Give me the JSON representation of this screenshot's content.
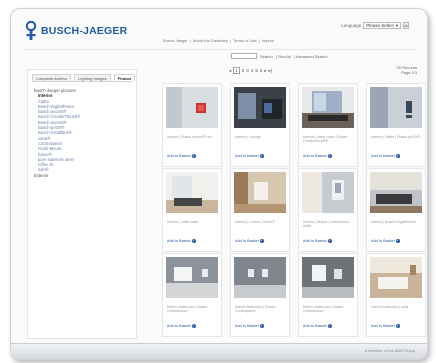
{
  "header": {
    "brand": "BUSCH-JAEGER",
    "language_label": "Language",
    "language_value": "Please Select",
    "language_ok": "ok",
    "top_links": [
      "Busch-Jaeger",
      "|",
      "About the Database",
      "|",
      "Terms of Use",
      "|",
      "Imprint"
    ]
  },
  "search": {
    "title": "Advanced Search | Extended Search",
    "placeholder": "",
    "search_label": "Search",
    "links": [
      "Search",
      "| Find All",
      "| Advanced Search"
    ]
  },
  "sidebar": {
    "tabs": [
      "Complete Archive",
      "Lighting Images",
      "Photos"
    ],
    "active_tab": 2,
    "tree": [
      {
        "label": "Busch-Jaeger pictures",
        "level": 0
      },
      {
        "label": "Interior",
        "level": 1,
        "selected": true
      },
      {
        "label": "Alpha",
        "level": 1
      },
      {
        "label": "Busch-DigitalRoom",
        "level": 1
      },
      {
        "label": "Busch-axcent®",
        "level": 1
      },
      {
        "label": "Busch-ComfortTouch®",
        "level": 1
      },
      {
        "label": "Busch-axcent®",
        "level": 1
      },
      {
        "label": "Busch-priOn®",
        "level": 1
      },
      {
        "label": "Busch-Installbus®",
        "level": 1
      },
      {
        "label": "carat®",
        "level": 1
      },
      {
        "label": "Controlpanel",
        "level": 1
      },
      {
        "label": "Flush-Mount",
        "level": 1
      },
      {
        "label": "future®",
        "level": 1
      },
      {
        "label": "pure stainless steel",
        "level": 1
      },
      {
        "label": "reflex SI",
        "level": 1
      },
      {
        "label": "solo®",
        "level": 1
      },
      {
        "label": "Exterior",
        "level": 0
      }
    ]
  },
  "pager": {
    "prev": "◂",
    "pages": [
      "1",
      "2",
      "3",
      "4",
      "5",
      "6"
    ],
    "current": "1",
    "next": "▸",
    "last": "▸|"
  },
  "results": {
    "line1": "30 Records",
    "line2": "Page 1/3"
  },
  "cards": [
    {
      "caption": "Interior | Busch-axcent® red",
      "add": "Add to Basket",
      "scene": "wall-switch"
    },
    {
      "caption": "Interior | Lounge",
      "add": "Add to Basket",
      "scene": "dark-room"
    },
    {
      "caption": "Interior | living room | Busch-ComfortTouch®",
      "add": "Add to Basket",
      "scene": "window-room"
    },
    {
      "caption": "Interior | Stairs | Busch-priOn®",
      "add": "Add to Basket",
      "scene": "stairs"
    },
    {
      "caption": "Interior | white base",
      "add": "Add to Basket",
      "scene": "bright-room"
    },
    {
      "caption": "Interior | Corner | future®",
      "add": "Add to Basket",
      "scene": "wood-room"
    },
    {
      "caption": "Interior | Busch-Controlpanel white",
      "add": "Add to Basket",
      "scene": "panel-wall"
    },
    {
      "caption": "Interior | Busch-DigitalRoom",
      "add": "Add to Basket",
      "scene": "lounge"
    },
    {
      "caption": "Interior bathroom | Busch-Controlpanel",
      "add": "Add to Basket",
      "scene": "grey-wall"
    },
    {
      "caption": "Interior bathroom | Busch-Controlpanel",
      "add": "Add to Basket",
      "scene": "grey-wall2"
    },
    {
      "caption": "Interior bathroom | Busch-Controlpanel",
      "add": "Add to Basket",
      "scene": "grey-wall3"
    },
    {
      "caption": "Interior bathroom | sofa",
      "add": "Add to Basket",
      "scene": "bathroom"
    }
  ],
  "footer": {
    "text": "a member of the ABB Group"
  },
  "colors": {
    "brand_blue": "#1d5aa8",
    "link_blue": "#2a56a0"
  }
}
